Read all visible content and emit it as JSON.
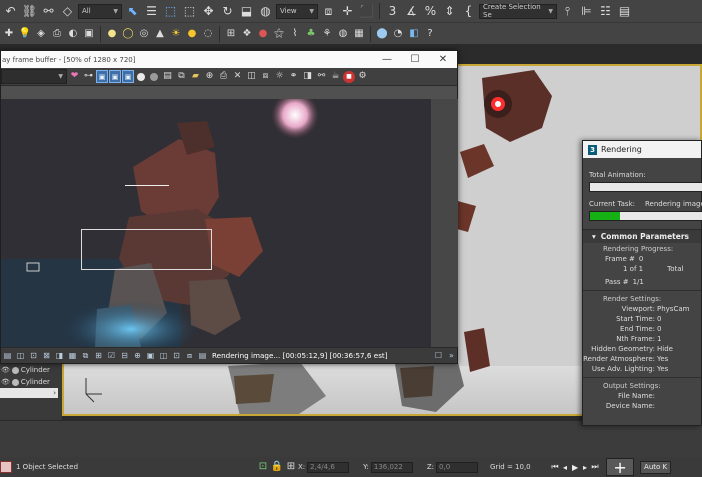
{
  "toolbar_top": {
    "filter_value": "All",
    "view_value": "View",
    "selection_set_value": "Create Selection Se"
  },
  "vfb": {
    "title": "ay frame buffer - [50% of 1280 x 720]",
    "status_message": "Rendering image... [00:05:12,9] [00:36:57,6 est]",
    "colors": {
      "toggle_active": "#3f6fa8",
      "canvas_bg": "#2e2e33"
    }
  },
  "scene_explorer": {
    "items": [
      {
        "label": "Cylinder"
      },
      {
        "label": "Cylinder"
      }
    ],
    "field_value": "00"
  },
  "rendering_dialog": {
    "title": "Rendering",
    "logo_text": "3",
    "total_animation_label": "Total Animation:",
    "current_task_label": "Current Task:",
    "current_task_value": "Rendering image...",
    "current_task_progress": 0.27,
    "section_title": "Common Parameters",
    "progress_label": "Rendering Progress:",
    "frame_label": "Frame #",
    "frame_value": "0",
    "frame_count": "1 of 1",
    "total_label": "Total",
    "pass_label": "Pass #",
    "pass_value": "1/1",
    "settings_label": "Render Settings:",
    "settings": [
      {
        "k": "Viewport:",
        "v": "PhysCam"
      },
      {
        "k": "Start Time:",
        "v": "0"
      },
      {
        "k": "End Time:",
        "v": "0"
      },
      {
        "k": "Nth Frame:",
        "v": "1"
      },
      {
        "k": "Hidden Geometry:",
        "v": "Hide"
      },
      {
        "k": "Render Atmosphere:",
        "v": "Yes"
      },
      {
        "k": "Use Adv. Lighting:",
        "v": "Yes"
      }
    ],
    "output_label": "Output Settings:",
    "output": [
      {
        "k": "File Name:",
        "v": ""
      },
      {
        "k": "Device Name:",
        "v": ""
      }
    ],
    "colors": {
      "progress_fill": "#14b014"
    }
  },
  "status_bar": {
    "selection_text": "1 Object Selected",
    "x_label": "X:",
    "x_value": "2,4/4,6",
    "y_label": "Y:",
    "y_value": "136,022",
    "z_label": "Z:",
    "z_value": "0,0",
    "grid_text": "Grid = 10,0",
    "autokey_label": "Auto K"
  },
  "viewport": {
    "border_color": "#c9a735"
  }
}
